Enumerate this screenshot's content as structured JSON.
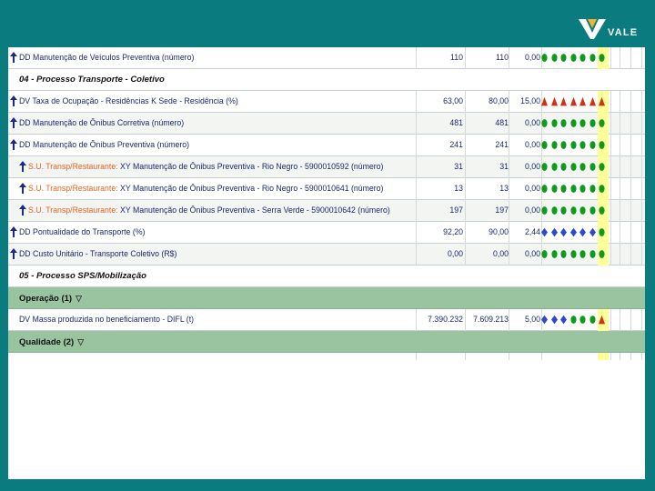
{
  "brand": {
    "logo_text": "VALE",
    "color_bg": "#0a7b7e"
  },
  "colors": {
    "green": "#0f9a1a",
    "red": "#d23015",
    "blue": "#2b4ad2",
    "yellow_col": "#ffff9a",
    "group_bg": "#9ac39f"
  },
  "rows": [
    {
      "kind": "item",
      "arrow": true,
      "prefix": "",
      "label": "DD Manutenção de Veículos Preventiva (número)",
      "v1": "110",
      "v2": "110",
      "v3": "0,00",
      "icons": [
        "green",
        "green",
        "green",
        "green",
        "green",
        "green",
        "green"
      ]
    },
    {
      "kind": "section",
      "label": "04 - Processo Transporte - Coletivo"
    },
    {
      "kind": "item",
      "arrow": true,
      "prefix": "",
      "label": "DV Taxa de Ocupação - Residências K Sede - Residência (%)",
      "v1": "63,00",
      "v2": "80,00",
      "v3": "15,00",
      "icons": [
        "red",
        "red",
        "red",
        "red",
        "red",
        "red",
        "red"
      ]
    },
    {
      "kind": "item",
      "arrow": true,
      "prefix": "",
      "label": "DD Manutenção de Ônibus Corretiva (número)",
      "v1": "481",
      "v2": "481",
      "v3": "0,00",
      "icons": [
        "green",
        "green",
        "green",
        "green",
        "green",
        "green",
        "green"
      ]
    },
    {
      "kind": "item",
      "arrow": true,
      "prefix": "",
      "label": "DD Manutenção de Ônibus Preventiva (número)",
      "v1": "241",
      "v2": "241",
      "v3": "0,00",
      "icons": [
        "green",
        "green",
        "green",
        "green",
        "green",
        "green",
        "green"
      ]
    },
    {
      "kind": "sub",
      "arrow": true,
      "prefix": "S.U. Transp/Restaurante:",
      "label": " XY Manutenção de Ônibus Preventiva - Rio Negro - 5900010592 (número)",
      "v1": "31",
      "v2": "31",
      "v3": "0,00",
      "icons": [
        "green",
        "green",
        "green",
        "green",
        "green",
        "green",
        "green"
      ]
    },
    {
      "kind": "sub",
      "arrow": true,
      "prefix": "S.U. Transp/Restaurante:",
      "label": " XY Manutenção de Ônibus Preventiva - Rio Negro - 5900010641 (número)",
      "v1": "13",
      "v2": "13",
      "v3": "0,00",
      "icons": [
        "green",
        "green",
        "green",
        "green",
        "green",
        "green",
        "green"
      ]
    },
    {
      "kind": "sub",
      "arrow": true,
      "prefix": "S.U. Transp/Restaurante:",
      "label": " XY Manutenção de Ônibus Preventiva - Serra Verde - 5900010642 (número)",
      "v1": "197",
      "v2": "197",
      "v3": "0,00",
      "icons": [
        "green",
        "green",
        "green",
        "green",
        "green",
        "green",
        "green"
      ]
    },
    {
      "kind": "item",
      "arrow": true,
      "prefix": "",
      "label": "DD Pontualidade do Transporte (%)",
      "v1": "92,20",
      "v2": "90,00",
      "v3": "2,44",
      "icons": [
        "blue",
        "blue",
        "blue",
        "blue",
        "blue",
        "blue",
        "green"
      ]
    },
    {
      "kind": "item",
      "arrow": true,
      "prefix": "",
      "label": "DD Custo Unitário - Transporte Coletivo (R$)",
      "v1": "0,00",
      "v2": "0,00",
      "v3": "0,00",
      "icons": [
        "green",
        "green",
        "green",
        "green",
        "green",
        "green",
        "green"
      ]
    },
    {
      "kind": "section",
      "label": "05 - Processo SPS/Mobilização"
    },
    {
      "kind": "group",
      "label": "Operação (1)"
    },
    {
      "kind": "item",
      "arrow": false,
      "prefix": "",
      "label": "DV Massa produzida no beneficiamento - DIFL (t)",
      "v1": "7.390.232",
      "v2": "7.609.213",
      "v3": "5,00",
      "icons": [
        "blue",
        "blue",
        "blue",
        "green",
        "green",
        "green",
        "red"
      ]
    },
    {
      "kind": "group",
      "label": "Qualidade (2)"
    }
  ]
}
